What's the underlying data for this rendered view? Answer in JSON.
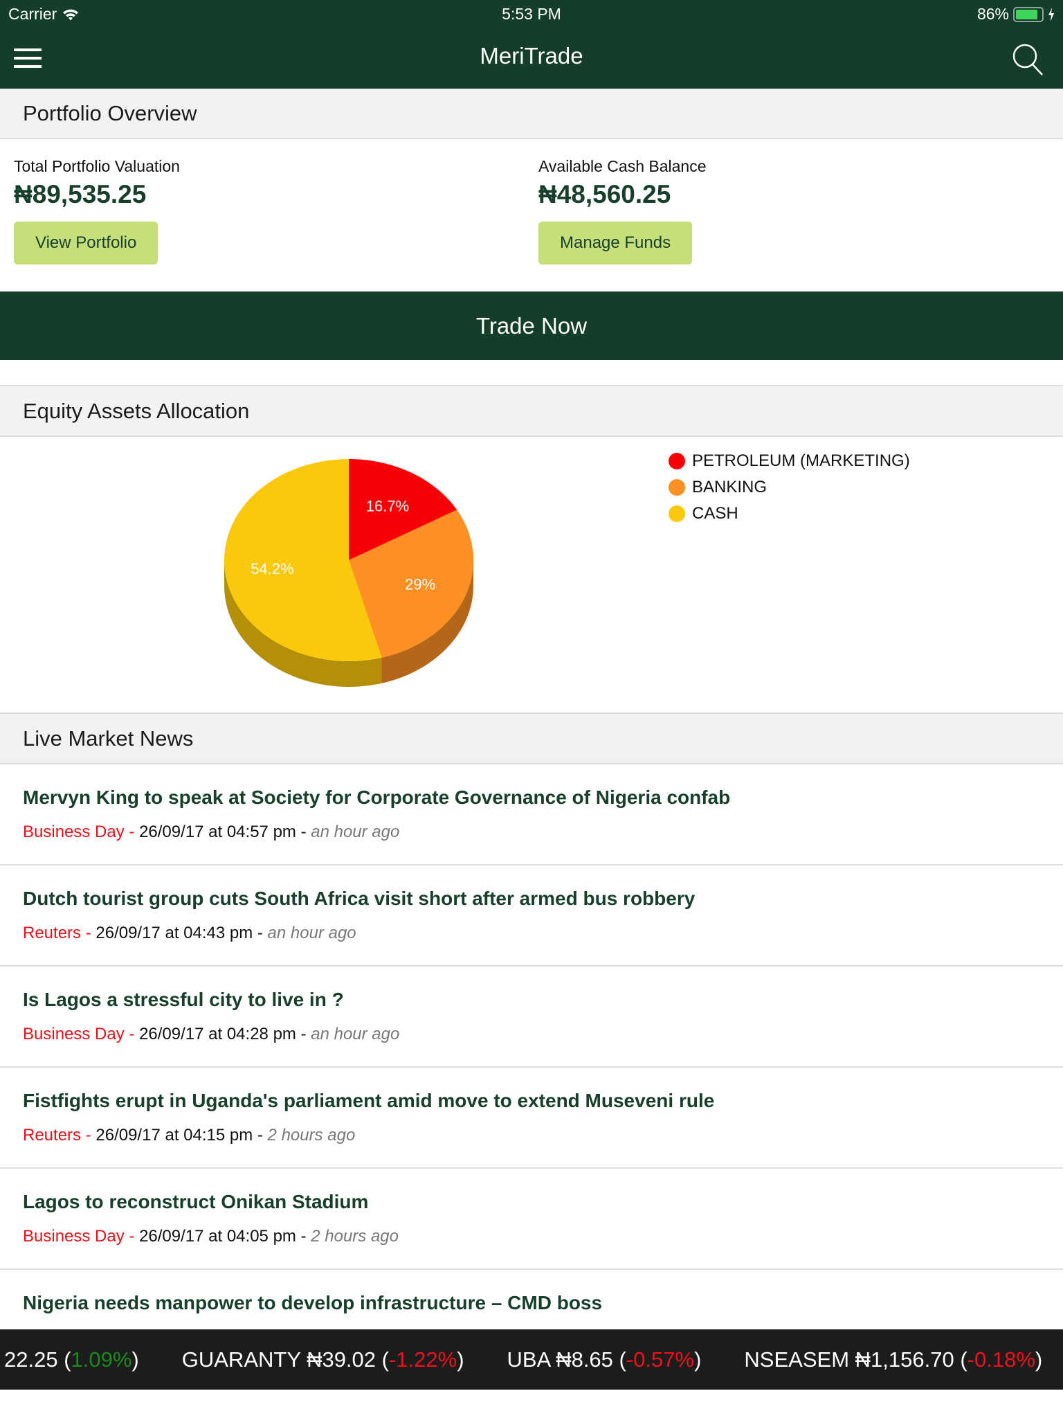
{
  "status_bar": {
    "carrier": "Carrier",
    "time": "5:53 PM",
    "battery": "86%"
  },
  "app": {
    "title": "MeriTrade"
  },
  "portfolio": {
    "heading": "Portfolio Overview",
    "valuation_label": "Total Portfolio Valuation",
    "valuation": "₦89,535.25",
    "view_button": "View Portfolio",
    "cash_label": "Available Cash Balance",
    "cash": "₦48,560.25",
    "funds_button": "Manage Funds"
  },
  "trade_button": "Trade Now",
  "allocation": {
    "heading": "Equity Assets Allocation"
  },
  "chart_data": {
    "type": "pie",
    "title": "Equity Assets Allocation",
    "slices": [
      {
        "label": "PETROLEUM (MARKETING)",
        "value": 16.7,
        "display": "16.7%",
        "color": "#f90006"
      },
      {
        "label": "BANKING",
        "value": 29,
        "display": "29%",
        "color": "#fc9024"
      },
      {
        "label": "CASH",
        "value": 54.2,
        "display": "54.2%",
        "color": "#fbc90c"
      }
    ],
    "legend_position": "right"
  },
  "news": {
    "heading": "Live Market News",
    "items": [
      {
        "title": "Mervyn King to speak at Society for Corporate Governance of Nigeria confab",
        "source": "Business Day",
        "date": "26/09/17 at 04:57 pm",
        "ago": "an hour ago"
      },
      {
        "title": "Dutch tourist group cuts South Africa visit short after armed bus robbery",
        "source": "Reuters",
        "date": "26/09/17 at 04:43 pm",
        "ago": "an hour ago"
      },
      {
        "title": "Is Lagos a stressful city to live in ?",
        "source": "Business Day",
        "date": "26/09/17 at 04:28 pm",
        "ago": "an hour ago"
      },
      {
        "title": "Fistfights erupt in Uganda's parliament amid move to extend Museveni rule",
        "source": "Reuters",
        "date": "26/09/17 at 04:15 pm",
        "ago": "2 hours ago"
      },
      {
        "title": "Lagos to reconstruct Onikan Stadium",
        "source": "Business Day",
        "date": "26/09/17 at 04:05 pm",
        "ago": "2 hours ago"
      },
      {
        "title": "Nigeria needs manpower to develop infrastructure – CMD boss",
        "source": "",
        "date": "",
        "ago": ""
      }
    ]
  },
  "ticker": [
    {
      "name": "",
      "price": "22.25",
      "change": "1.09%",
      "dir": "up"
    },
    {
      "name": "GUARANTY",
      "price": "₦39.02",
      "change": "-1.22%",
      "dir": "down"
    },
    {
      "name": "UBA",
      "price": "₦8.65",
      "change": "-0.57%",
      "dir": "down"
    },
    {
      "name": "NSEASEM",
      "price": "₦1,156.70",
      "change": "-0.18%",
      "dir": "down"
    }
  ]
}
